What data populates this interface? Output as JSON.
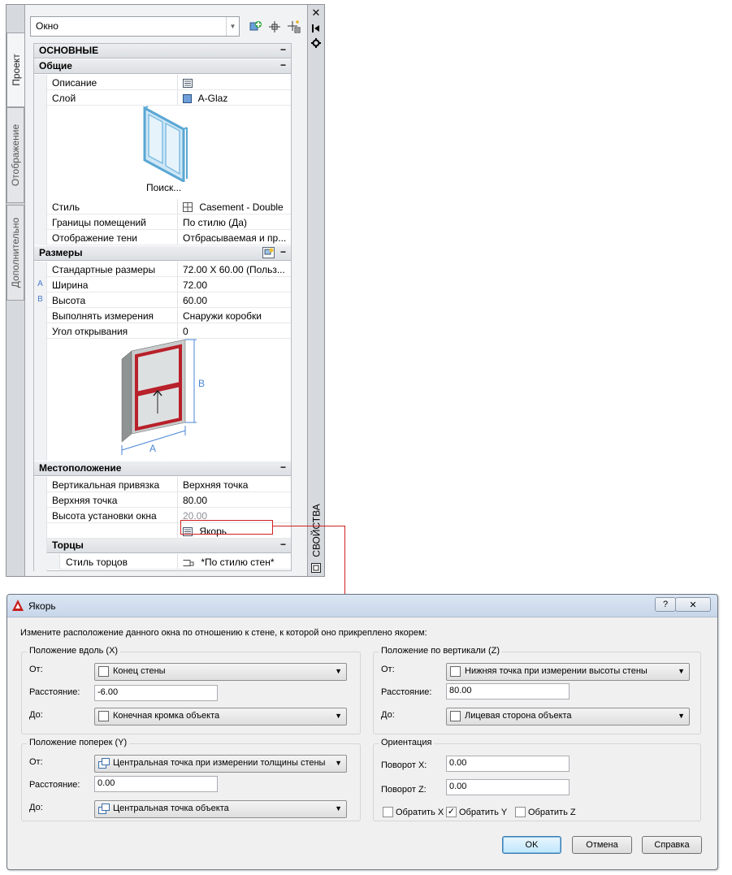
{
  "palette": {
    "object_combo": "Окно",
    "tabs": [
      "Проект",
      "Отображение",
      "Дополнительно"
    ],
    "strip_title": "СВОЙСТВА",
    "toolbar_icons": [
      "add-style-icon",
      "select-objects-icon",
      "quick-select-icon"
    ],
    "categories": {
      "basic": "ОСНОВНЫЕ",
      "general": "Общие",
      "dimensions": "Размеры",
      "location": "Местоположение",
      "ends": "Торцы"
    },
    "general_props": [
      {
        "name": "Описание",
        "value": ""
      },
      {
        "name": "Слой",
        "value": "A-Glaz"
      }
    ],
    "preview_caption": "Поиск...",
    "style_props": [
      {
        "name": "Стиль",
        "value": "Casement - Double"
      },
      {
        "name": "Границы помещений",
        "value": "По стилю (Да)"
      },
      {
        "name": "Отображение тени",
        "value": "Отбрасываемая и пр..."
      }
    ],
    "dimension_props": [
      {
        "gutter": "",
        "name": "Стандартные размеры",
        "value": "72.00  X  60.00 (Польз..."
      },
      {
        "gutter": "A",
        "name": "Ширина",
        "value": "72.00"
      },
      {
        "gutter": "B",
        "name": "Высота",
        "value": "60.00"
      },
      {
        "gutter": "",
        "name": "Выполнять измерения",
        "value": "Снаружи коробки"
      },
      {
        "gutter": "",
        "name": "Угол открывания",
        "value": "0"
      }
    ],
    "dim_labels": {
      "a": "A",
      "b": "B"
    },
    "location_props": [
      {
        "name": "Вертикальная привязка",
        "value": "Верхняя точка"
      },
      {
        "name": "Верхняя точка",
        "value": "80.00"
      },
      {
        "name": "Высота установки окна",
        "value": "20.00"
      },
      {
        "name": "",
        "value": "Якорь"
      }
    ],
    "ends_props": [
      {
        "name": "Стиль торцов",
        "value": "*По стилю стен*"
      }
    ]
  },
  "dialog": {
    "title": "Якорь",
    "help": "?",
    "instruction": "Измените расположение данного окна по отношению к стене, к которой оно прикреплено якорем:",
    "along": {
      "label": "Положение вдоль (X)",
      "from_label": "От:",
      "from_value": "Конец стены",
      "distance_label": "Расстояние:",
      "distance_value": "-6.00",
      "to_label": "До:",
      "to_value": "Конечная кромка объекта"
    },
    "across": {
      "label": "Положение поперек (Y)",
      "from_label": "От:",
      "from_value": "Центральная точка при измерении толщины стены",
      "distance_label": "Расстояние:",
      "distance_value": "0.00",
      "to_label": "До:",
      "to_value": "Центральная точка объекта"
    },
    "vertical": {
      "label": "Положение по вертикали (Z)",
      "from_label": "От:",
      "from_value": "Нижняя точка при измерении высоты стены",
      "distance_label": "Расстояние:",
      "distance_value": "80.00",
      "to_label": "До:",
      "to_value": "Лицевая сторона объекта"
    },
    "orientation": {
      "label": "Ориентация",
      "rot_x_label": "Поворот X:",
      "rot_x_value": "0.00",
      "rot_z_label": "Поворот Z:",
      "rot_z_value": "0.00",
      "flip_x": {
        "label": "Обратить X",
        "checked": false
      },
      "flip_y": {
        "label": "Обратить Y",
        "checked": true
      },
      "flip_z": {
        "label": "Обратить Z",
        "checked": false
      }
    },
    "buttons": {
      "ok": "OK",
      "cancel": "Отмена",
      "help": "Справка"
    }
  },
  "colors": {
    "callout": "#d02020",
    "glass": "#a9d3ec",
    "frame_red": "#b8202a",
    "dim_blue": "#4a86d8"
  }
}
